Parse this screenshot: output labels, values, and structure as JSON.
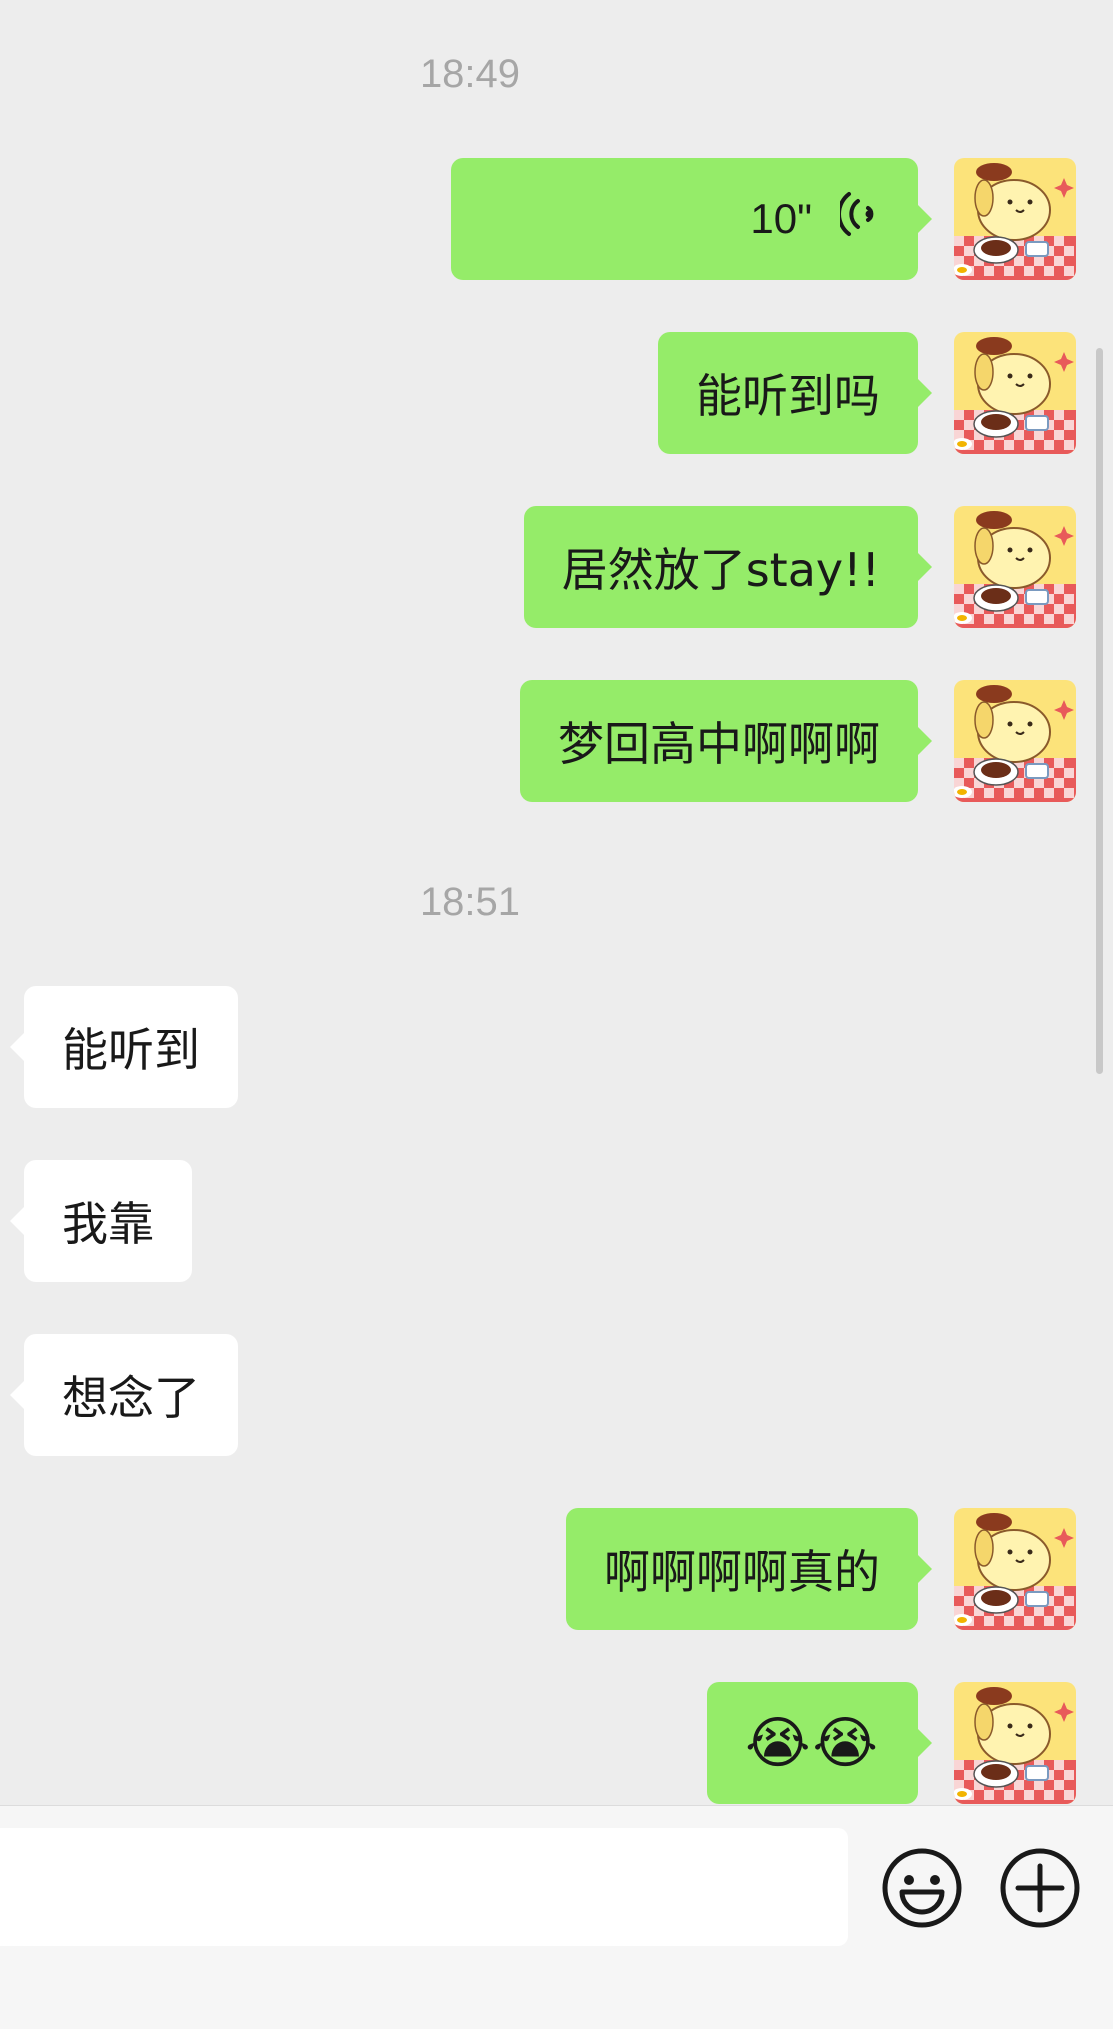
{
  "chat": {
    "timestamps": [
      "18:49",
      "18:51"
    ],
    "messages": [
      {
        "side": "out",
        "type": "voice",
        "duration": "10\""
      },
      {
        "side": "out",
        "type": "text",
        "text": "能听到吗"
      },
      {
        "side": "out",
        "type": "text",
        "text": "居然放了stay!!"
      },
      {
        "side": "out",
        "type": "text",
        "text": "梦回高中啊啊啊"
      },
      {
        "side": "in",
        "type": "text",
        "text": "能听到"
      },
      {
        "side": "in",
        "type": "text",
        "text": "我靠"
      },
      {
        "side": "in",
        "type": "text",
        "text": "想念了"
      },
      {
        "side": "out",
        "type": "text",
        "text": "啊啊啊啊真的"
      },
      {
        "side": "out",
        "type": "emoji",
        "text": "😭😭"
      }
    ]
  },
  "avatar_icon": "pompompurin-avatar",
  "voice_icon": "voice-wave-icon",
  "input_bar": {
    "value": "",
    "emoji_icon": "smiley-icon",
    "plus_icon": "plus-circle-icon"
  },
  "colors": {
    "outgoing_bubble": "#95ec69",
    "incoming_bubble": "#ffffff",
    "background": "#ededed",
    "timestamp_text": "#a6a6a6"
  }
}
